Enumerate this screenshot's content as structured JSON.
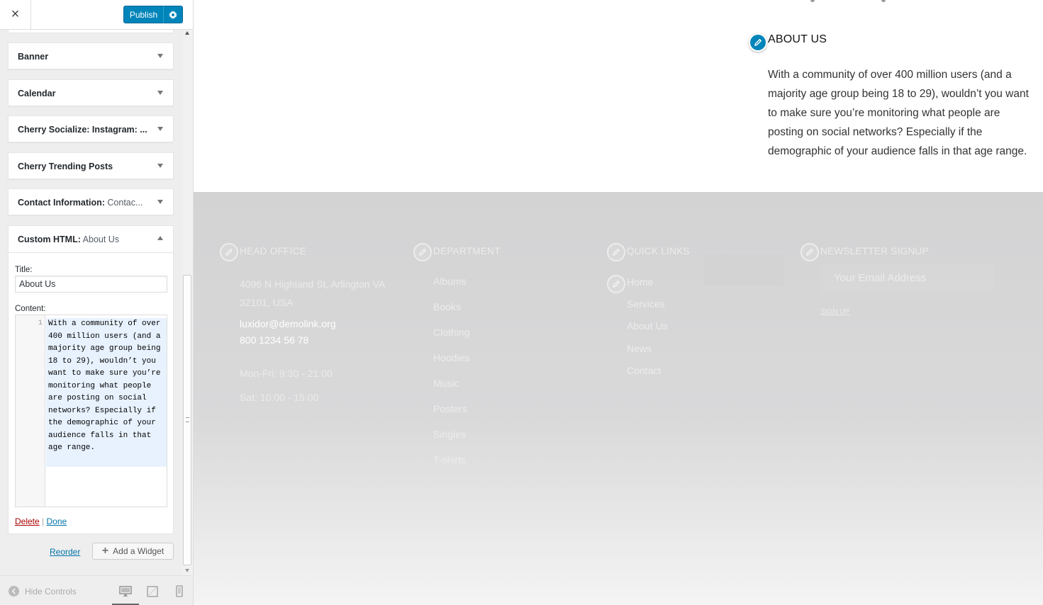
{
  "customizer": {
    "close_icon": "×",
    "publish_label": "Publish",
    "settings_icon": "gear-icon",
    "widgets": [
      {
        "title": "Banner",
        "subtitle": ""
      },
      {
        "title": "Calendar",
        "subtitle": ""
      },
      {
        "title": "Cherry Socialize: Instagram: ...",
        "subtitle": ""
      },
      {
        "title": "Cherry Trending Posts",
        "subtitle": ""
      },
      {
        "title": "Contact Information:",
        "subtitle": " Contac..."
      }
    ],
    "open_widget": {
      "title": "Custom HTML:",
      "subtitle": " About Us",
      "title_label": "Title:",
      "title_value": "About Us",
      "content_label": "Content:",
      "line_number": "1",
      "content": "With a community of over 400 million users (and a majority age group being 18 to 29), wouldn’t you want to make sure you’re monitoring what people are posting on social networks? Especially if the demographic of your audience falls in that age range.",
      "delete_label": "Delete",
      "separator": "|",
      "done_label": "Done"
    },
    "reorder_label": "Reorder",
    "add_widget_label": "Add a Widget",
    "hide_controls_label": "Hide Controls"
  },
  "preview": {
    "about": {
      "heading": "ABOUT US",
      "text": "With a community of over 400 million users (and a majority age group being 18 to 29), wouldn’t you want to make sure you’re monitoring what people are posting on social networks? Especially if the demographic of your audience falls in that age range."
    },
    "footer": {
      "head_office": {
        "title": "HEAD OFFICE",
        "address_line1": "4096 N Highland St, Arlington VA",
        "address_line2": "32101, USA",
        "email": "luxidor@demolink.org",
        "phone": "800 1234 56 78",
        "hours_weekday": "Mon-Fri: 9:30 - 21:00",
        "hours_saturday": "Sat: 10:00 - 15:00"
      },
      "department": {
        "title": "DEPARTMENT",
        "items": [
          "Albums",
          "Books",
          "Clothing",
          "Hoodies",
          "Music",
          "Posters",
          "Singles",
          "T-shirts"
        ]
      },
      "quick_links": {
        "title": "QUICK LINKS",
        "items": [
          "Home",
          "Services",
          "About Us",
          "News",
          "Contact"
        ]
      },
      "newsletter": {
        "title": "NEWSLETTER SIGNUP",
        "placeholder": "Your Email Address",
        "signup_label": "SIGN UP"
      },
      "social_icons": [
        "linkedin-icon",
        "twitter-icon",
        "facebook-icon",
        "instagram-icon"
      ]
    }
  },
  "colors": {
    "accent": "#0085ba",
    "footer_bg": "#d3d3d4"
  }
}
